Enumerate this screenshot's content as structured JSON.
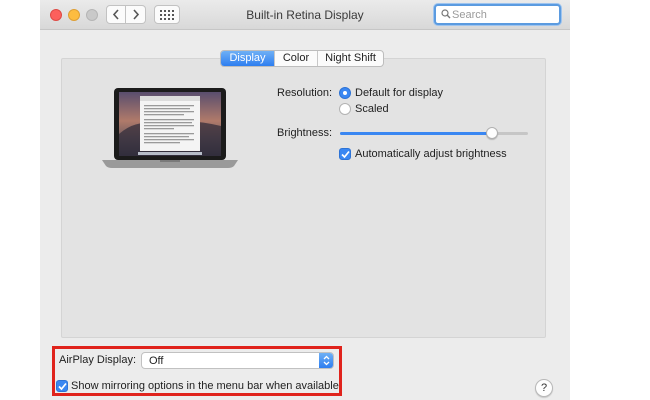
{
  "window": {
    "title": "Built-in Retina Display",
    "search_placeholder": "Search"
  },
  "toolbar": {
    "back_icon": "chevron-left-icon",
    "forward_icon": "chevron-right-icon",
    "show_all_icon": "grid-icon"
  },
  "tabs": [
    {
      "label": "Display",
      "selected": true
    },
    {
      "label": "Color",
      "selected": false
    },
    {
      "label": "Night Shift",
      "selected": false
    }
  ],
  "display": {
    "resolution_label": "Resolution:",
    "resolution_options": [
      {
        "label": "Default for display",
        "selected": true
      },
      {
        "label": "Scaled",
        "selected": false
      }
    ],
    "brightness_label": "Brightness:",
    "brightness_level": 0.81,
    "auto_brightness_label": "Automatically adjust brightness",
    "auto_brightness_checked": true
  },
  "airplay": {
    "label": "AirPlay Display:",
    "value": "Off",
    "mirroring_label": "Show mirroring options in the menu bar when available",
    "mirroring_checked": true
  },
  "help": {
    "label": "?"
  },
  "colors": {
    "accent": "#3a87f2",
    "highlight_border": "#e0231c"
  }
}
